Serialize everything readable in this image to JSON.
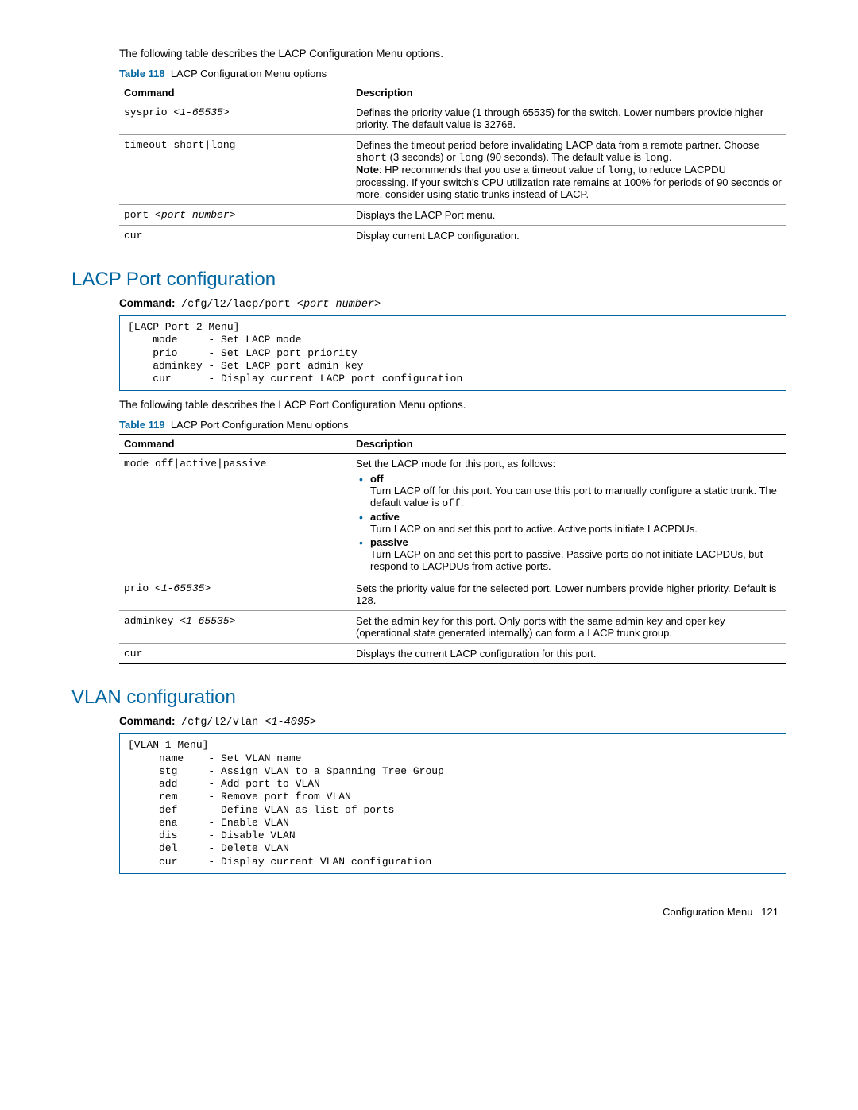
{
  "intro1": "The following table describes the LACP Configuration Menu options.",
  "table118": {
    "label": "Table 118",
    "caption": "LACP Configuration Menu options",
    "headers": {
      "c1": "Command",
      "c2": "Description"
    },
    "rows": [
      {
        "cmd": "sysprio ",
        "arg": "<1-65535>",
        "desc": "Defines the priority value (1 through 65535) for the switch. Lower numbers provide higher priority. The default value is 32768."
      },
      {
        "cmd": "timeout short|long",
        "arg": "",
        "desc_pre": "Defines the timeout period before invalidating LACP data from a remote partner. Choose ",
        "mono1": "short",
        "desc_mid1": " (3 seconds) or ",
        "mono2": "long",
        "desc_mid2": " (90 seconds). The default value is ",
        "mono3": "long",
        "desc_post1": ".",
        "note_label": "Note",
        "note_text": ": HP recommends that you use a timeout value of ",
        "mono4": "long",
        "note_tail": ", to reduce LACPDU processing. If your switch's CPU utilization rate remains at 100% for periods of 90 seconds or more, consider using static trunks instead of LACP."
      },
      {
        "cmd": "port ",
        "arg": "<port number>",
        "desc": "Displays the LACP Port menu."
      },
      {
        "cmd": "cur",
        "arg": "",
        "desc": "Display current LACP configuration."
      }
    ]
  },
  "section_lacp_port": {
    "title": "LACP Port configuration",
    "cmd_label": "Command:",
    "cmd_path": "/cfg/l2/lacp/port ",
    "cmd_arg": "<port number>",
    "terminal": "[LACP Port 2 Menu]\n    mode     - Set LACP mode\n    prio     - Set LACP port priority\n    adminkey - Set LACP port admin key\n    cur      - Display current LACP port configuration",
    "intro": "The following table describes the LACP Port Configuration Menu options."
  },
  "table119": {
    "label": "Table 119",
    "caption": "LACP Port Configuration Menu options",
    "headers": {
      "c1": "Command",
      "c2": "Description"
    },
    "rows": [
      {
        "cmd": "mode off|active|passive",
        "lead": "Set the LACP mode for this port, as follows:",
        "bullets": [
          {
            "name": "off",
            "text": "Turn LACP off for this port. You can use this port to manually configure a static trunk. The default value is ",
            "mono": "off",
            "tail": "."
          },
          {
            "name": "active",
            "text": "Turn LACP on and set this port to active. Active ports initiate LACPDUs."
          },
          {
            "name": "passive",
            "text": "Turn LACP on and set this port to passive. Passive ports do not initiate LACPDUs, but respond to LACPDUs from active ports."
          }
        ]
      },
      {
        "cmd": "prio ",
        "arg": "<1-65535>",
        "desc": "Sets the priority value for the selected port. Lower numbers provide higher priority. Default is 128."
      },
      {
        "cmd": "adminkey ",
        "arg": "<1-65535>",
        "desc": "Set the admin key for this port. Only ports with the same admin key and oper key (operational state generated internally) can form a LACP trunk group."
      },
      {
        "cmd": "cur",
        "arg": "",
        "desc": "Displays the current LACP configuration for this port."
      }
    ]
  },
  "section_vlan": {
    "title": "VLAN configuration",
    "cmd_label": "Command:",
    "cmd_path": "/cfg/l2/vlan ",
    "cmd_arg": "<1-4095>",
    "terminal": "[VLAN 1 Menu]\n     name    - Set VLAN name\n     stg     - Assign VLAN to a Spanning Tree Group\n     add     - Add port to VLAN\n     rem     - Remove port from VLAN\n     def     - Define VLAN as list of ports\n     ena     - Enable VLAN\n     dis     - Disable VLAN\n     del     - Delete VLAN\n     cur     - Display current VLAN configuration"
  },
  "footer": {
    "section": "Configuration Menu",
    "page": "121"
  }
}
